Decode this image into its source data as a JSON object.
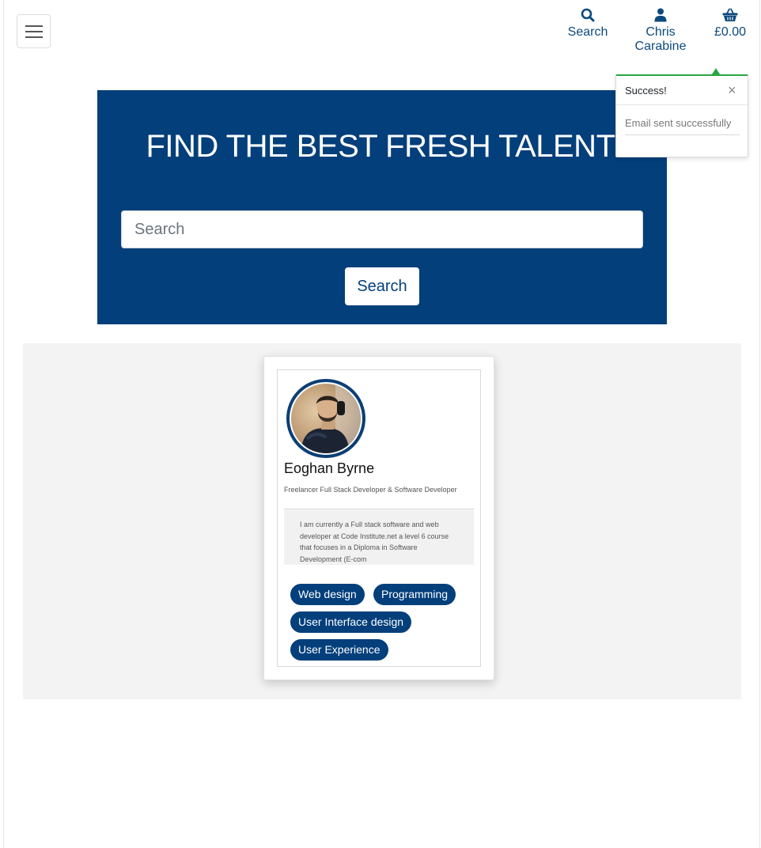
{
  "nav": {
    "search_label": "Search",
    "user_label": "Chris Carabine",
    "basket_label": "£0.00"
  },
  "hero": {
    "title": "FIND THE BEST FRESH TALENT",
    "search_placeholder": "Search",
    "search_button": "Search"
  },
  "profile": {
    "name": "Eoghan Byrne",
    "headline": "Freelancer Full Stack Developer & Software Developer",
    "bio": "I am currently a Full stack software and web developer at Code Institute.net a level 6 course that focuses in a Diploma in Software Development (E-com",
    "skills": [
      "Web design",
      "Programming",
      "User Interface design",
      "User Experience"
    ]
  },
  "toast": {
    "title": "Success!",
    "close": "×",
    "message": "Email sent successfully"
  },
  "colors": {
    "brand": "#033f7b",
    "success": "#28a745"
  }
}
